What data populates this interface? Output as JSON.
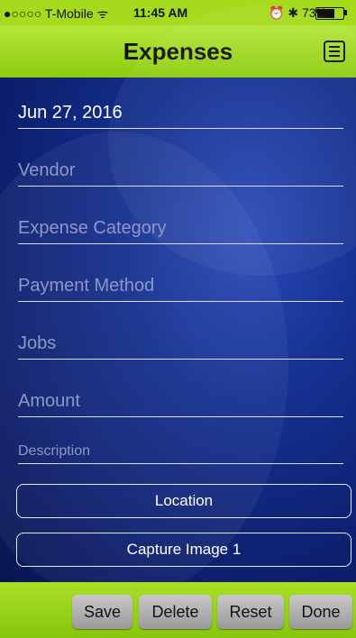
{
  "status_bar": {
    "carrier": "●○○○○ T-Mobile ᯤ",
    "time": "11:45 AM",
    "right_icons": "⏰ ✱ 73%",
    "battery_percent": 73
  },
  "nav": {
    "title": "Expenses",
    "menu_icon": "hamburger-menu-icon"
  },
  "form": {
    "date": "Jun 27, 2016",
    "vendor_placeholder": "Vendor",
    "category_placeholder": "Expense Category",
    "payment_placeholder": "Payment Method",
    "jobs_placeholder": "Jobs",
    "amount_placeholder": "Amount",
    "description_placeholder": "Description"
  },
  "buttons": {
    "location": "Location",
    "capture_image": "Capture Image 1"
  },
  "toolbar": {
    "save": "Save",
    "delete": "Delete",
    "reset": "Reset",
    "done": "Done"
  },
  "colors": {
    "bar_green": "#a5db1c",
    "background_blue": "#15308f"
  }
}
